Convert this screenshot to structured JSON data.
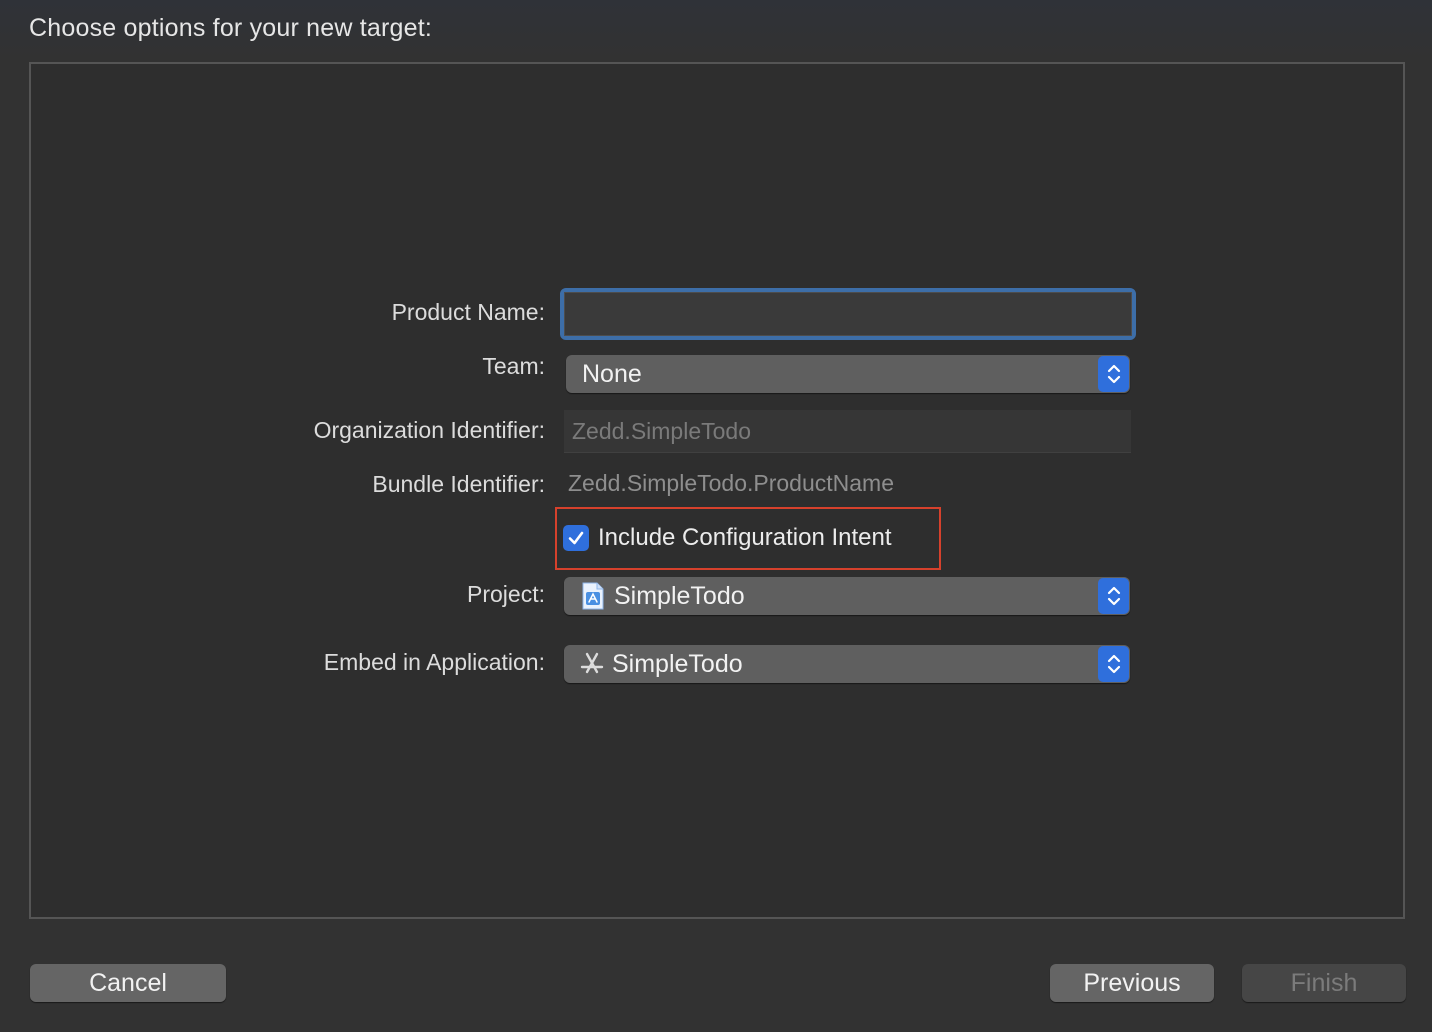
{
  "header": {
    "title": "Choose options for your new target:"
  },
  "form": {
    "product_name": {
      "label": "Product Name:",
      "value": "",
      "placeholder": ""
    },
    "team": {
      "label": "Team:",
      "value": "None"
    },
    "organization_identifier": {
      "label": "Organization Identifier:",
      "value": "Zedd.SimpleTodo"
    },
    "bundle_identifier": {
      "label": "Bundle Identifier:",
      "value": "Zedd.SimpleTodo.ProductName"
    },
    "include_configuration_intent": {
      "label": "Include Configuration Intent",
      "checked": true
    },
    "project": {
      "label": "Project:",
      "value": "SimpleTodo",
      "icon": "xcode-project-file-icon"
    },
    "embed_in_application": {
      "label": "Embed in Application:",
      "value": "SimpleTodo",
      "icon": "app-store-icon"
    }
  },
  "footer": {
    "cancel_label": "Cancel",
    "previous_label": "Previous",
    "finish_label": "Finish",
    "finish_enabled": false
  },
  "colors": {
    "accent": "#2f6fdc",
    "focus_ring": "#3d6ea8",
    "annotation_outline": "#d6412c"
  }
}
